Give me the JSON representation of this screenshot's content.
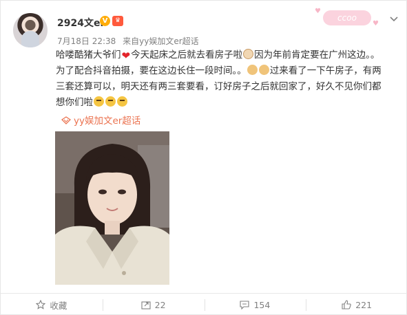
{
  "post": {
    "username": "2924文er",
    "verified_mark": "V",
    "vip_mark": "",
    "time": "7月18日 22:38",
    "from_prefix": "来自",
    "source": "yy娱加文er超话",
    "text_lines": [
      "哈喽酷猪大爷们",
      "今天起床之后就去看房子啦",
      "因为年前肯定要在广州这边。。",
      "为了配合抖音拍摄，要在这边长住一段时间。。",
      "过来看了一下午房子，有两",
      "三套还算可以，明天还有两三套要看，订好房子之后就回家了，好久不见你们都",
      "想你们啦"
    ],
    "topic_link": "yy娱加文er超话",
    "deco_text": "ccoo",
    "icons": {
      "avatar": "avatar",
      "expand": "chevron-down-icon",
      "heart_emoji": "red-heart",
      "topic": "super-topic-icon"
    }
  },
  "actions": [
    {
      "label": "收藏",
      "icon": "star-icon"
    },
    {
      "label": "22",
      "icon": "repost-icon"
    },
    {
      "label": "154",
      "icon": "comment-icon"
    },
    {
      "label": "221",
      "icon": "like-icon"
    }
  ],
  "colors": {
    "link": "#eb7350",
    "meta": "#808080",
    "text": "#333333"
  }
}
